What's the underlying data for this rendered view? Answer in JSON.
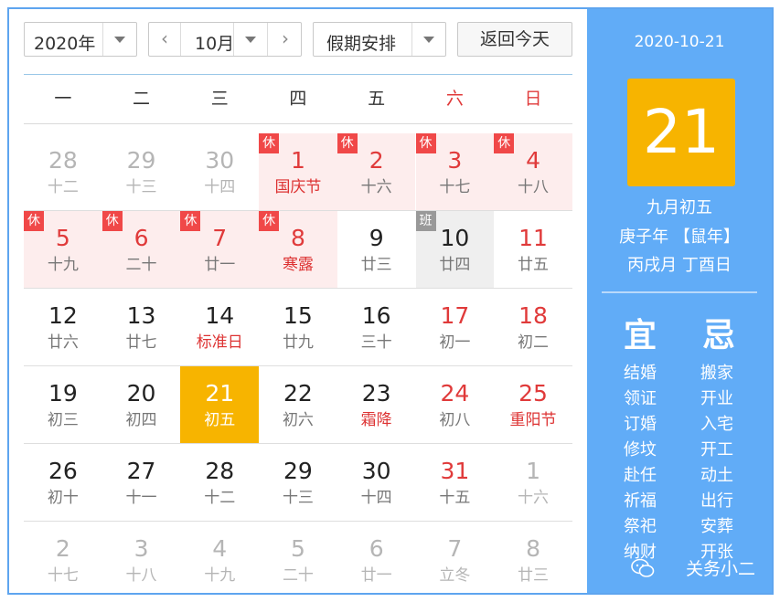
{
  "toolbar": {
    "year": "2020年",
    "prev": "‹",
    "month": "10月",
    "next": "›",
    "holiday": "假期安排",
    "today_btn": "返回今天"
  },
  "weekdays": [
    "一",
    "二",
    "三",
    "四",
    "五",
    "六",
    "日"
  ],
  "rows": [
    [
      {
        "num": "28",
        "lun": "十二",
        "gray": true
      },
      {
        "num": "29",
        "lun": "十三",
        "gray": true
      },
      {
        "num": "30",
        "lun": "十四",
        "gray": true
      },
      {
        "num": "1",
        "lun": "国庆节",
        "tag": "休",
        "rest": true,
        "fest": true,
        "wk": true
      },
      {
        "num": "2",
        "lun": "十六",
        "tag": "休",
        "rest": true,
        "wk": true
      },
      {
        "num": "3",
        "lun": "十七",
        "tag": "休",
        "rest": true,
        "wk": true
      },
      {
        "num": "4",
        "lun": "十八",
        "tag": "休",
        "rest": true,
        "wk": true
      }
    ],
    [
      {
        "num": "5",
        "lun": "十九",
        "tag": "休",
        "rest": true,
        "wk": true
      },
      {
        "num": "6",
        "lun": "二十",
        "tag": "休",
        "rest": true,
        "wk": true
      },
      {
        "num": "7",
        "lun": "廿一",
        "tag": "休",
        "rest": true,
        "wk": true
      },
      {
        "num": "8",
        "lun": "寒露",
        "tag": "休",
        "rest": true,
        "fest": true,
        "wk": true
      },
      {
        "num": "9",
        "lun": "廿三"
      },
      {
        "num": "10",
        "lun": "廿四",
        "tag": "班",
        "work": true
      },
      {
        "num": "11",
        "lun": "廿五",
        "wk": true
      }
    ],
    [
      {
        "num": "12",
        "lun": "廿六"
      },
      {
        "num": "13",
        "lun": "廿七"
      },
      {
        "num": "14",
        "lun": "标准日",
        "fest": true
      },
      {
        "num": "15",
        "lun": "廿九"
      },
      {
        "num": "16",
        "lun": "三十"
      },
      {
        "num": "17",
        "lun": "初一",
        "wk": true
      },
      {
        "num": "18",
        "lun": "初二",
        "wk": true
      }
    ],
    [
      {
        "num": "19",
        "lun": "初三"
      },
      {
        "num": "20",
        "lun": "初四"
      },
      {
        "num": "21",
        "lun": "初五",
        "sel": true
      },
      {
        "num": "22",
        "lun": "初六"
      },
      {
        "num": "23",
        "lun": "霜降",
        "fest": true
      },
      {
        "num": "24",
        "lun": "初八",
        "wk": true
      },
      {
        "num": "25",
        "lun": "重阳节",
        "fest": true,
        "wk": true
      }
    ],
    [
      {
        "num": "26",
        "lun": "初十"
      },
      {
        "num": "27",
        "lun": "十一"
      },
      {
        "num": "28",
        "lun": "十二"
      },
      {
        "num": "29",
        "lun": "十三"
      },
      {
        "num": "30",
        "lun": "十四"
      },
      {
        "num": "31",
        "lun": "十五",
        "wk": true
      },
      {
        "num": "1",
        "lun": "十六",
        "gray": true
      }
    ],
    [
      {
        "num": "2",
        "lun": "十七",
        "gray": true
      },
      {
        "num": "3",
        "lun": "十八",
        "gray": true
      },
      {
        "num": "4",
        "lun": "十九",
        "gray": true
      },
      {
        "num": "5",
        "lun": "二十",
        "gray": true
      },
      {
        "num": "6",
        "lun": "廿一",
        "gray": true
      },
      {
        "num": "7",
        "lun": "立冬",
        "gray": true
      },
      {
        "num": "8",
        "lun": "廿三",
        "gray": true
      }
    ]
  ],
  "panel": {
    "date": "2020-10-21",
    "day": "21",
    "lunar": "九月初五",
    "ganzhi_year": "庚子年 【鼠年】",
    "ganzhi_day": "丙戌月 丁酉日",
    "yi_title": "宜",
    "ji_title": "忌",
    "yi": [
      "结婚",
      "领证",
      "订婚",
      "修坟",
      "赴任",
      "祈福",
      "祭祀",
      "纳财"
    ],
    "ji": [
      "搬家",
      "开业",
      "入宅",
      "开工",
      "动土",
      "出行",
      "安葬",
      "开张"
    ],
    "watermark": "关务小二"
  },
  "colors": {
    "accent": "#61acf7",
    "selected": "#f7b400",
    "holiday_bg": "#fdeded",
    "red": "#e03a3a"
  }
}
